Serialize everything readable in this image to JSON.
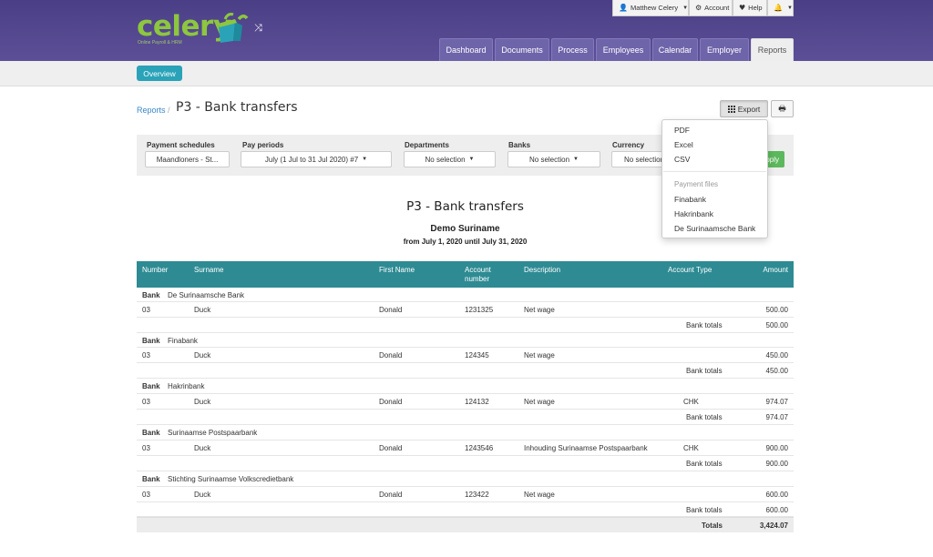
{
  "brand": {
    "name": "celery",
    "tagline": "Online Payroll & HRM",
    "colors": {
      "header": "#4f438b",
      "accent": "#2aa3b8",
      "table_header": "#2e8b93",
      "apply": "#5cb85c"
    }
  },
  "topbar": {
    "user": "Matthew Celery",
    "account": "Account",
    "help": "Help"
  },
  "nav": [
    "Dashboard",
    "Documents",
    "Process",
    "Employees",
    "Calendar",
    "Employer",
    "Reports"
  ],
  "subnav": {
    "overview": "Overview"
  },
  "breadcrumb": {
    "parent": "Reports",
    "separator": "/",
    "title": "P3 - Bank transfers"
  },
  "actions": {
    "export": "Export"
  },
  "export_menu": {
    "items": [
      "PDF",
      "Excel",
      "CSV"
    ],
    "header": "Payment files",
    "payment_files": [
      "Finabank",
      "Hakrinbank",
      "De Surinaamsche Bank"
    ]
  },
  "filters": {
    "payment_schedules": {
      "label": "Payment schedules",
      "value": "Maandloners - St..."
    },
    "pay_periods": {
      "label": "Pay periods",
      "value": "July (1 Jul to 31 Jul 2020) #7"
    },
    "departments": {
      "label": "Departments",
      "value": "No selection"
    },
    "banks": {
      "label": "Banks",
      "value": "No selection"
    },
    "currency": {
      "label": "Currency",
      "value": "No selection"
    },
    "apply": "Apply"
  },
  "report": {
    "title": "P3 - Bank transfers",
    "company": "Demo Suriname",
    "period": "from July 1, 2020 until July 31, 2020",
    "columns": {
      "number": "Number",
      "surname": "Surname",
      "first_name": "First Name",
      "account_number_1": "Account",
      "account_number_2": "number",
      "description": "Description",
      "account_type": "Account Type",
      "amount": "Amount"
    },
    "bank_label": "Bank",
    "totals_label": "Bank totals",
    "groups": [
      {
        "bank": "De Surinaamsche Bank",
        "number": "03",
        "surname": "Duck",
        "first_name": "Donald",
        "account": "1231325",
        "description": "Net wage",
        "type": "",
        "amount": "500.00",
        "total": "500.00"
      },
      {
        "bank": "Finabank",
        "number": "03",
        "surname": "Duck",
        "first_name": "Donald",
        "account": "124345",
        "description": "Net wage",
        "type": "",
        "amount": "450.00",
        "total": "450.00"
      },
      {
        "bank": "Hakrinbank",
        "number": "03",
        "surname": "Duck",
        "first_name": "Donald",
        "account": "124132",
        "description": "Net wage",
        "type": "CHK",
        "amount": "974.07",
        "total": "974.07"
      },
      {
        "bank": "Surinaamse Postspaarbank",
        "number": "03",
        "surname": "Duck",
        "first_name": "Donald",
        "account": "1243546",
        "description": "Inhouding Surinaamse Postspaarbank",
        "type": "CHK",
        "amount": "900.00",
        "total": "900.00"
      },
      {
        "bank": "Stichting Surinaamse Volkscredietbank",
        "number": "03",
        "surname": "Duck",
        "first_name": "Donald",
        "account": "123422",
        "description": "Net wage",
        "type": "",
        "amount": "600.00",
        "total": "600.00"
      }
    ],
    "grand_total_label": "Totals",
    "grand_total": "3,424.07"
  }
}
